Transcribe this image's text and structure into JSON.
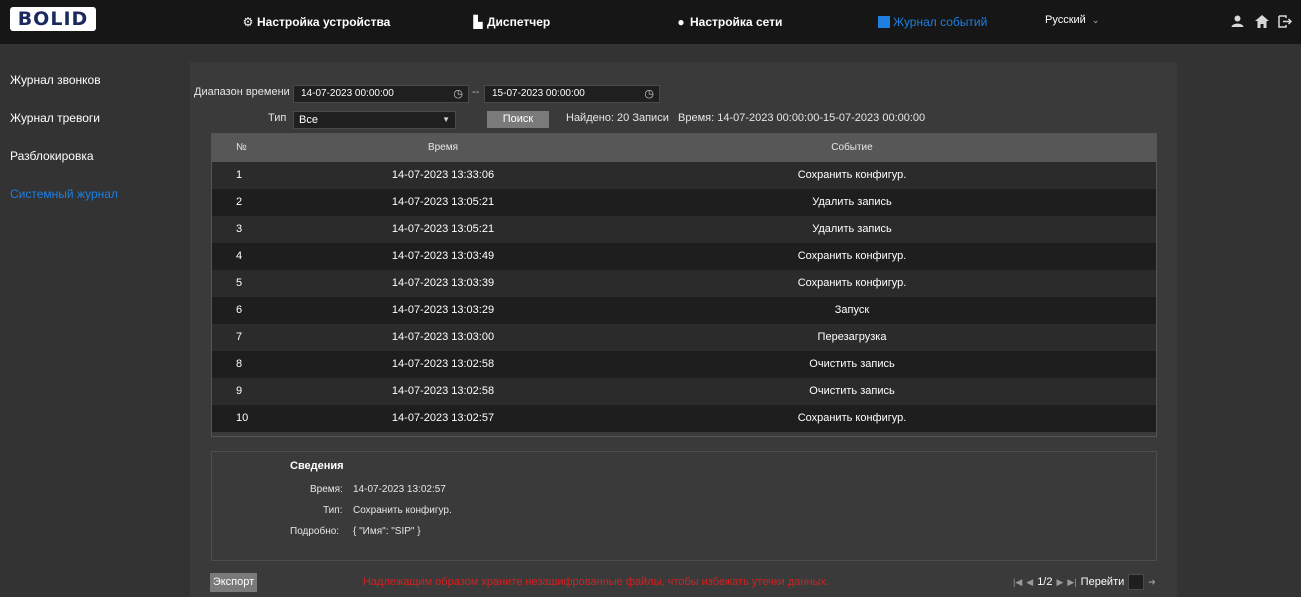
{
  "brand": {
    "logo_text": "BOLID"
  },
  "nav": {
    "items": [
      {
        "label": "Настройка устройства",
        "icon": "gear-icon"
      },
      {
        "label": "Диспетчер",
        "icon": "building-icon"
      },
      {
        "label": "Настройка сети",
        "icon": "globe-icon"
      },
      {
        "label": "Журнал событий",
        "icon": "journal-icon",
        "active": true
      }
    ],
    "language": "Русский",
    "language_arrow": "⌄"
  },
  "top_icons": [
    "user-icon",
    "home-icon",
    "logout-icon"
  ],
  "sidebar": {
    "items": [
      {
        "label": "Журнал звонков"
      },
      {
        "label": "Журнал тревоги"
      },
      {
        "label": "Разблокировка"
      },
      {
        "label": "Системный журнал",
        "active": true
      }
    ]
  },
  "filters": {
    "range_label": "Диапазон времени",
    "start": "14-07-2023 00:00:00",
    "separator": "--",
    "end": "15-07-2023 00:00:00",
    "type_label": "Тип",
    "type_value": "Все",
    "search_label": "Поиск",
    "found_text": "Найдено: 20 Записи",
    "range_text": "Время: 14-07-2023 00:00:00-15-07-2023 00:00:00"
  },
  "table": {
    "headers": {
      "no": "№",
      "time": "Время",
      "event": "Событие"
    },
    "rows": [
      {
        "no": "1",
        "time": "14-07-2023 13:33:06",
        "event": "Сохранить конфигур."
      },
      {
        "no": "2",
        "time": "14-07-2023 13:05:21",
        "event": "Удалить запись"
      },
      {
        "no": "3",
        "time": "14-07-2023 13:05:21",
        "event": "Удалить запись"
      },
      {
        "no": "4",
        "time": "14-07-2023 13:03:49",
        "event": "Сохранить конфигур."
      },
      {
        "no": "5",
        "time": "14-07-2023 13:03:39",
        "event": "Сохранить конфигур."
      },
      {
        "no": "6",
        "time": "14-07-2023 13:03:29",
        "event": "Запуск"
      },
      {
        "no": "7",
        "time": "14-07-2023 13:03:00",
        "event": "Перезагрузка"
      },
      {
        "no": "8",
        "time": "14-07-2023 13:02:58",
        "event": "Очистить запись"
      },
      {
        "no": "9",
        "time": "14-07-2023 13:02:58",
        "event": "Очистить запись"
      },
      {
        "no": "10",
        "time": "14-07-2023 13:02:57",
        "event": "Сохранить конфигур."
      }
    ]
  },
  "details": {
    "title": "Сведения",
    "time_label": "Время:",
    "time_value": "14-07-2023 13:02:57",
    "type_label": "Тип:",
    "type_value": "Сохранить конфигур.",
    "detail_label": "Подробно:",
    "detail_value": "{ \"Имя\": \"SIP\" }"
  },
  "footer": {
    "export_label": "Экспорт",
    "warning": "Надлежащим образом храните незашифрованные файлы, чтобы избежать утечки данных.",
    "page": "1/2",
    "goto_label": "Перейти"
  },
  "colors": {
    "accent": "#1e7fe0",
    "warning": "#d42020",
    "topbar": "#161616",
    "background": "#333333"
  }
}
